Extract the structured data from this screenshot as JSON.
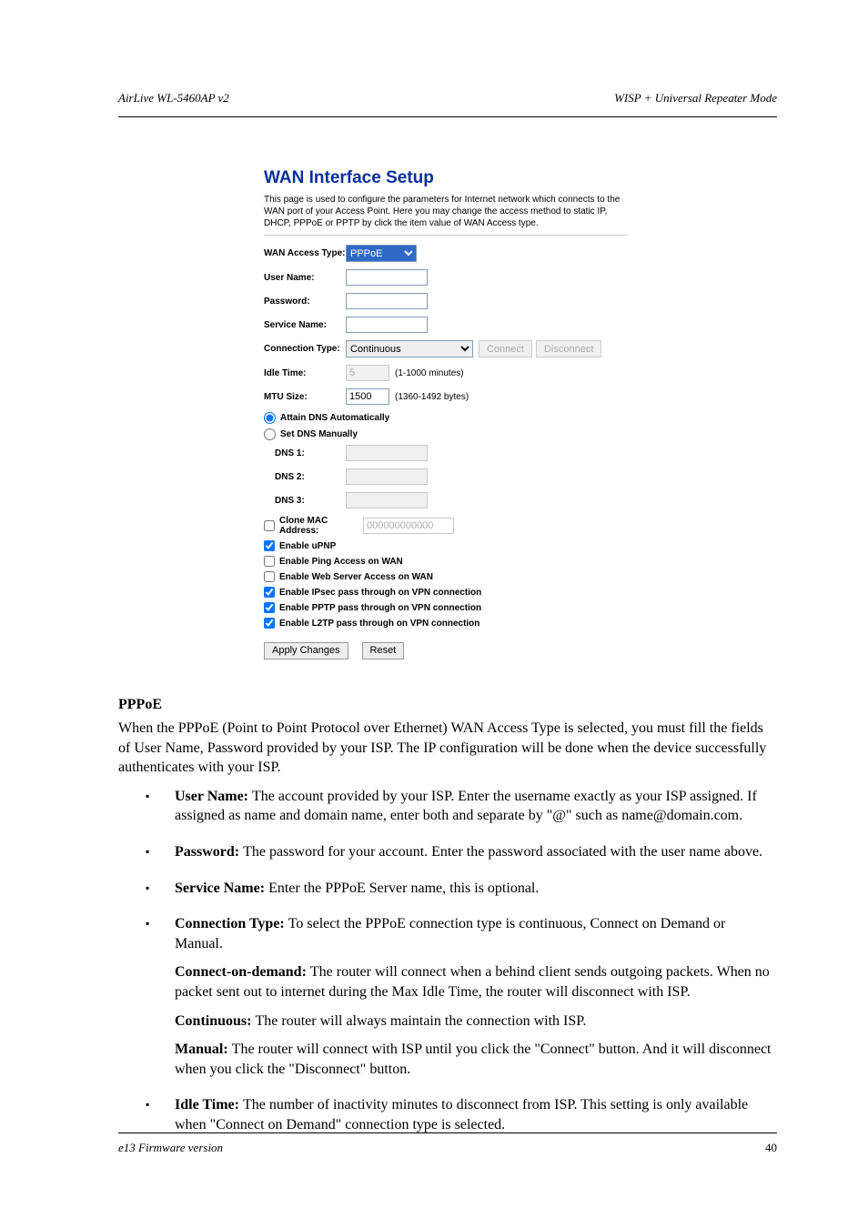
{
  "header": {
    "product": "AirLive WL-5460AP v2",
    "page_title": "WISP + Universal Repeater Mode"
  },
  "footer": {
    "version": "e13 Firmware version",
    "page": "40"
  },
  "panel": {
    "title": "WAN Interface Setup",
    "description": "This page is used to configure the parameters for Internet network which connects to the WAN port of your Access Point. Here you may change the access method to static IP, DHCP, PPPoE or PPTP by click the item value of WAN Access type.",
    "labels": {
      "wan_access_type": "WAN Access Type:",
      "user_name": "User Name:",
      "password": "Password:",
      "service_name": "Service Name:",
      "connection_type": "Connection Type:",
      "idle_time": "Idle Time:",
      "mtu_size": "MTU Size:",
      "dns_auto": "Attain DNS Automatically",
      "dns_manual": "Set DNS Manually",
      "dns1": "DNS 1:",
      "dns2": "DNS 2:",
      "dns3": "DNS 3:",
      "clone_mac": "Clone MAC Address:",
      "enable_upnp": "Enable uPNP",
      "enable_ping": "Enable Ping Access on WAN",
      "enable_web": "Enable Web Server Access on WAN",
      "enable_ipsec": "Enable IPsec pass through on VPN connection",
      "enable_pptp": "Enable PPTP pass through on VPN connection",
      "enable_l2tp": "Enable L2TP pass through on VPN connection"
    },
    "values": {
      "wan_access_type": "PPPoE",
      "user_name": "",
      "password": "",
      "service_name": "",
      "connection_type": "Continuous",
      "idle_time": "5",
      "mtu_size": "1500",
      "dns1": "",
      "dns2": "",
      "dns3": "",
      "clone_mac": "000000000000"
    },
    "hints": {
      "idle_time": "(1-1000 minutes)",
      "mtu_size": "(1360-1492 bytes)"
    },
    "buttons": {
      "connect": "Connect",
      "disconnect": "Disconnect",
      "apply": "Apply Changes",
      "reset": "Reset"
    }
  },
  "content": {
    "pppoe_heading": "PPPoE",
    "pppoe_body": "When the PPPoE (Point to Point Protocol over Ethernet) WAN Access Type is selected, you must fill the fields of User Name, Password provided by your ISP. The IP configuration will be done when the device successfully authenticates with your ISP.",
    "bullets": [
      {
        "head": "User Name: ",
        "body": "The account provided by your ISP. Enter the username exactly as your ISP assigned. If assigned as name and domain name, enter both and separate by \"@\" such as name@domain.com."
      },
      {
        "head": "Password: ",
        "body": "The password for your account. Enter the password associated with the user name above."
      },
      {
        "head": "Service Name: ",
        "body": "Enter the PPPoE Server name, this is optional."
      },
      {
        "head": "Connection Type: ",
        "body": "To select the PPPoE connection type is continuous, Connect on Demand or Manual.",
        "sub": [
          {
            "head": "Connect-on-demand: ",
            "body": "The router will connect when a behind client sends outgoing packets. When no packet sent out to internet during the Max Idle Time, the router will disconnect with ISP."
          },
          {
            "head": "Continuous: ",
            "body": "The router will always maintain the connection with ISP."
          },
          {
            "head": "Manual: ",
            "body": "The router will connect with ISP until you click the \"Connect\" button. And it will disconnect when you click the \"Disconnect\" button."
          }
        ]
      },
      {
        "head": "Idle Time: ",
        "body": "The number of inactivity minutes to disconnect from ISP. This setting is only available when \"Connect on Demand\" connection type is selected."
      }
    ]
  }
}
